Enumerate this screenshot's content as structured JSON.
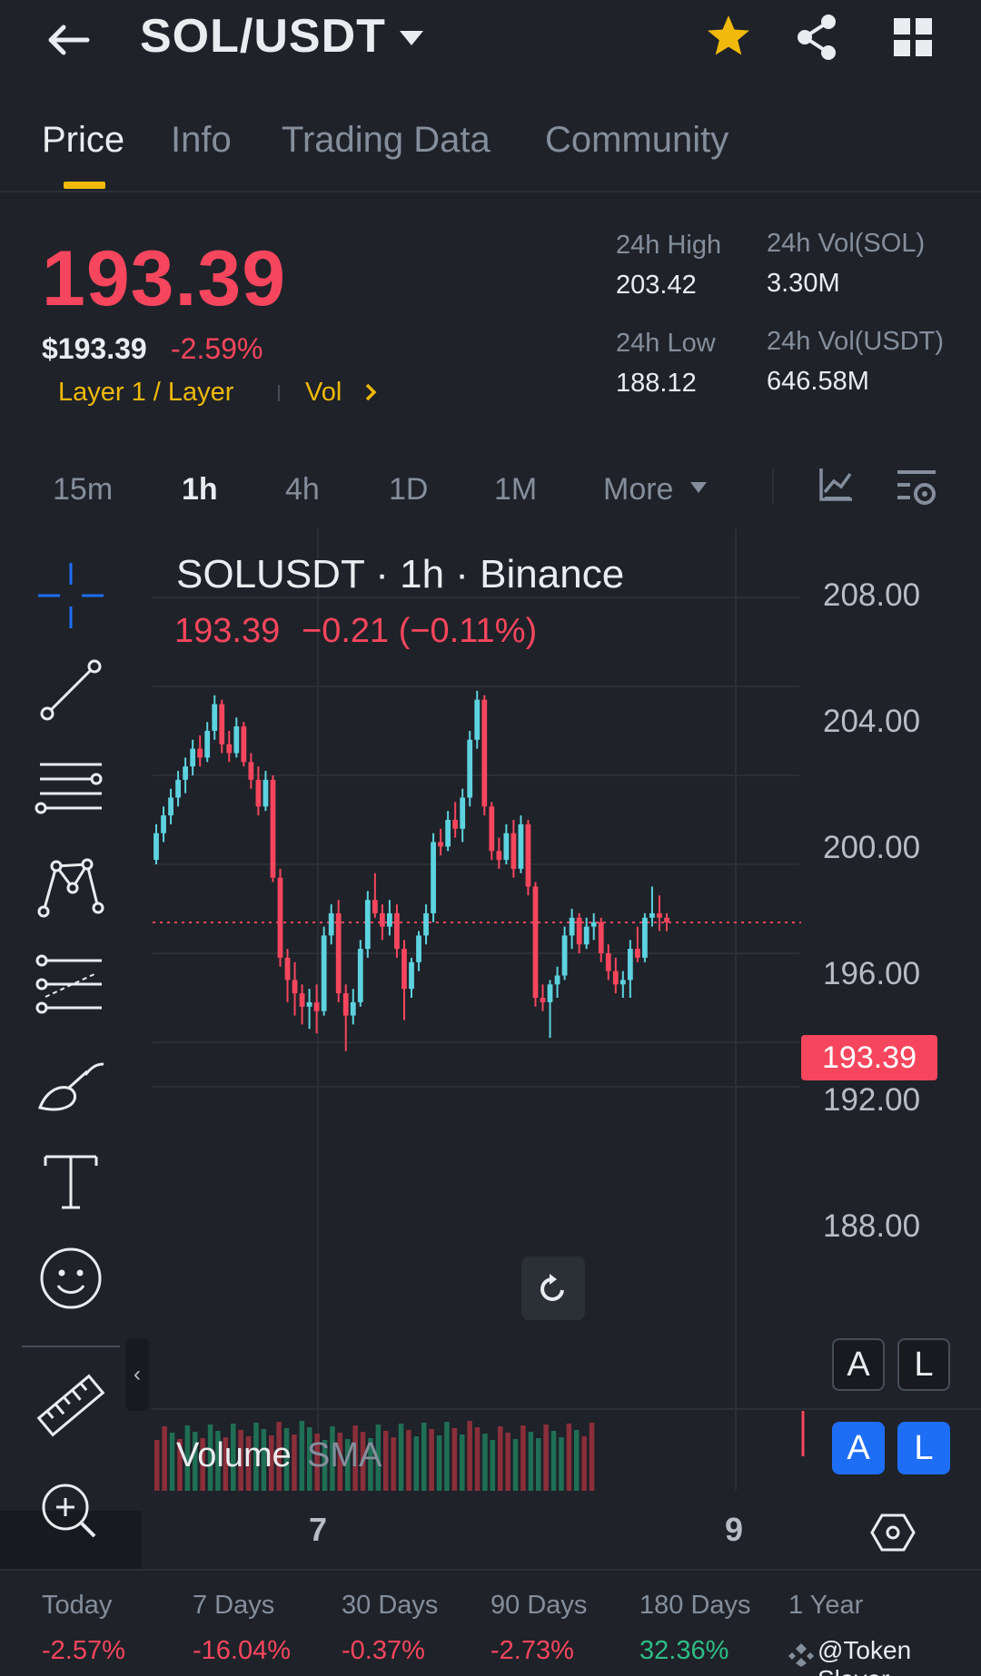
{
  "header": {
    "pair": "SOL/USDT",
    "icons": [
      "back-arrow-icon",
      "caret-down-icon",
      "star-icon",
      "share-icon",
      "grid-icon"
    ],
    "star_color": "#f0b90b"
  },
  "tabs": [
    {
      "label": "Price",
      "active": true
    },
    {
      "label": "Info",
      "active": false
    },
    {
      "label": "Trading Data",
      "active": false
    },
    {
      "label": "Community",
      "active": false
    }
  ],
  "price": {
    "last": "193.39",
    "usd": "$193.39",
    "change_pct": "-2.59%",
    "tags": {
      "category": "Layer 1 / Layer",
      "vol": "Vol"
    }
  },
  "stats": {
    "high_label": "24h High",
    "high": "203.42",
    "low_label": "24h Low",
    "low": "188.12",
    "vol_base_label": "24h Vol(SOL)",
    "vol_base": "3.30M",
    "vol_quote_label": "24h Vol(USDT)",
    "vol_quote": "646.58M"
  },
  "intervals": [
    {
      "label": "15m",
      "active": false
    },
    {
      "label": "1h",
      "active": true
    },
    {
      "label": "4h",
      "active": false
    },
    {
      "label": "1D",
      "active": false
    },
    {
      "label": "1M",
      "active": false
    },
    {
      "label": "More",
      "active": false
    }
  ],
  "chart": {
    "title": "SOLUSDT · 1h · Binance",
    "last": "193.39",
    "change": "−0.21 (−0.11%)",
    "price_tag": "193.39",
    "yticks": [
      "208.00",
      "204.00",
      "200.00",
      "196.00",
      "192.00",
      "188.00"
    ],
    "xticks": [
      "7",
      "9"
    ],
    "volume_label": "Volume",
    "volume_sma": "SMA",
    "btn_a": "A",
    "btn_l": "L",
    "collapse": "‹",
    "up_color": "#5dd3e0",
    "down_color": "#f6465d"
  },
  "chart_data": {
    "type": "candlestick",
    "interval": "1h",
    "ylim": [
      186,
      210
    ],
    "yticks": [
      188,
      192,
      196,
      200,
      204,
      208
    ],
    "last_price": 193.39,
    "candles_ohlc": [
      [
        196.2,
        197.8,
        196.0,
        197.4
      ],
      [
        197.4,
        198.6,
        197.0,
        198.2
      ],
      [
        198.2,
        199.4,
        197.8,
        199.0
      ],
      [
        199.0,
        200.2,
        198.6,
        199.8
      ],
      [
        199.8,
        200.8,
        199.2,
        200.4
      ],
      [
        200.4,
        201.6,
        200.0,
        201.2
      ],
      [
        201.2,
        201.8,
        200.4,
        200.8
      ],
      [
        200.8,
        202.4,
        200.6,
        202.0
      ],
      [
        202.0,
        203.6,
        201.6,
        203.2
      ],
      [
        203.2,
        203.4,
        201.0,
        201.4
      ],
      [
        201.4,
        202.0,
        200.6,
        201.0
      ],
      [
        201.0,
        202.6,
        200.8,
        202.2
      ],
      [
        202.2,
        202.4,
        200.4,
        200.6
      ],
      [
        200.6,
        201.0,
        199.4,
        199.8
      ],
      [
        199.8,
        200.4,
        198.2,
        198.6
      ],
      [
        198.6,
        200.2,
        198.4,
        199.8
      ],
      [
        199.8,
        200.0,
        195.2,
        195.4
      ],
      [
        195.4,
        195.8,
        191.4,
        191.8
      ],
      [
        191.8,
        192.2,
        189.8,
        190.8
      ],
      [
        190.8,
        191.6,
        189.2,
        190.2
      ],
      [
        190.2,
        190.6,
        188.8,
        189.6
      ],
      [
        189.6,
        190.4,
        188.6,
        189.8
      ],
      [
        189.8,
        190.6,
        188.4,
        189.4
      ],
      [
        189.4,
        193.2,
        189.2,
        192.8
      ],
      [
        192.8,
        194.2,
        192.4,
        193.8
      ],
      [
        193.8,
        194.4,
        189.8,
        190.2
      ],
      [
        190.2,
        190.6,
        187.6,
        189.2
      ],
      [
        189.2,
        190.4,
        188.8,
        189.8
      ],
      [
        189.8,
        192.6,
        189.6,
        192.2
      ],
      [
        192.2,
        194.8,
        191.8,
        194.4
      ],
      [
        194.4,
        195.6,
        193.6,
        193.8
      ],
      [
        193.8,
        194.2,
        192.6,
        193.2
      ],
      [
        193.2,
        194.4,
        192.8,
        193.8
      ],
      [
        193.8,
        194.2,
        191.8,
        192.2
      ],
      [
        192.2,
        192.6,
        189.0,
        190.4
      ],
      [
        190.4,
        191.8,
        190.0,
        191.6
      ],
      [
        191.6,
        193.0,
        191.2,
        192.8
      ],
      [
        192.8,
        194.2,
        192.4,
        193.8
      ],
      [
        193.8,
        197.4,
        193.4,
        197.0
      ],
      [
        197.0,
        197.6,
        196.4,
        196.8
      ],
      [
        196.8,
        198.4,
        196.6,
        198.0
      ],
      [
        198.0,
        198.8,
        197.2,
        197.6
      ],
      [
        197.6,
        199.4,
        197.0,
        199.0
      ],
      [
        199.0,
        202.0,
        198.6,
        201.6
      ],
      [
        201.6,
        203.8,
        201.2,
        203.4
      ],
      [
        203.4,
        203.6,
        198.2,
        198.6
      ],
      [
        198.6,
        198.8,
        196.2,
        196.6
      ],
      [
        196.6,
        197.2,
        195.8,
        196.2
      ],
      [
        196.2,
        197.8,
        196.0,
        197.4
      ],
      [
        197.4,
        198.0,
        195.4,
        195.8
      ],
      [
        195.8,
        198.2,
        195.6,
        197.8
      ],
      [
        197.8,
        198.0,
        194.6,
        195.0
      ],
      [
        195.0,
        195.2,
        189.6,
        190.0
      ],
      [
        190.0,
        190.6,
        189.4,
        189.8
      ],
      [
        189.8,
        190.8,
        188.2,
        190.6
      ],
      [
        190.6,
        191.4,
        190.0,
        191.0
      ],
      [
        191.0,
        193.2,
        190.8,
        192.8
      ],
      [
        192.8,
        194.0,
        192.2,
        193.6
      ],
      [
        193.6,
        193.8,
        192.0,
        192.4
      ],
      [
        192.4,
        193.6,
        192.2,
        193.2
      ],
      [
        193.2,
        193.8,
        192.6,
        193.4
      ],
      [
        193.4,
        193.6,
        191.6,
        192.0
      ],
      [
        192.0,
        192.4,
        190.8,
        191.2
      ],
      [
        191.2,
        191.8,
        190.2,
        190.6
      ],
      [
        190.6,
        191.2,
        190.0,
        190.8
      ],
      [
        190.8,
        192.6,
        190.0,
        192.2
      ],
      [
        192.2,
        193.2,
        191.6,
        191.8
      ],
      [
        191.8,
        193.8,
        191.6,
        193.6
      ],
      [
        193.6,
        195.0,
        193.2,
        193.8
      ],
      [
        193.8,
        194.6,
        193.0,
        193.6
      ],
      [
        193.6,
        193.8,
        193.0,
        193.39
      ]
    ],
    "volume_direction": "green and red bars"
  },
  "performance": [
    {
      "label": "Today",
      "value": "-2.57%",
      "dir": "neg"
    },
    {
      "label": "7 Days",
      "value": "-16.04%",
      "dir": "neg"
    },
    {
      "label": "30 Days",
      "value": "-0.37%",
      "dir": "neg"
    },
    {
      "label": "90 Days",
      "value": "-2.73%",
      "dir": "neg"
    },
    {
      "label": "180 Days",
      "value": "32.36%",
      "dir": "pos"
    },
    {
      "label": "1 Year",
      "value": "",
      "dir": "pos"
    }
  ],
  "watermark": "@Token Slayer"
}
